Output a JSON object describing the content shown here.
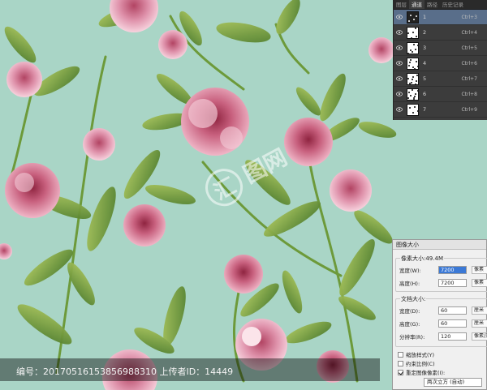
{
  "channels_panel": {
    "tabs": [
      "图层",
      "通道",
      "路径",
      "历史记录"
    ],
    "active_tab": 1,
    "channels": [
      {
        "name": "1",
        "shortcut": "Ctrl+3",
        "selected": true
      },
      {
        "name": "2",
        "shortcut": "Ctrl+4",
        "selected": false
      },
      {
        "name": "3",
        "shortcut": "Ctrl+5",
        "selected": false
      },
      {
        "name": "4",
        "shortcut": "Ctrl+6",
        "selected": false
      },
      {
        "name": "5",
        "shortcut": "Ctrl+7",
        "selected": false
      },
      {
        "name": "6",
        "shortcut": "Ctrl+8",
        "selected": false
      },
      {
        "name": "7",
        "shortcut": "Ctrl+9",
        "selected": false
      }
    ]
  },
  "image_size_dialog": {
    "title": "图像大小",
    "pixel_dimensions": {
      "legend": "像素大小:49.4M",
      "width_label": "宽度(W):",
      "width_value": "7200",
      "width_unit": "像素",
      "height_label": "高度(H):",
      "height_value": "7200",
      "height_unit": "像素"
    },
    "document_size": {
      "legend": "文档大小:",
      "width_label": "宽度(D):",
      "width_value": "60",
      "width_unit": "厘米",
      "height_label": "高度(G):",
      "height_value": "60",
      "height_unit": "厘米",
      "resolution_label": "分辨率(R):",
      "resolution_value": "120",
      "resolution_unit": "像素/英寸"
    },
    "checkboxes": [
      {
        "label": "缩放样式(Y)",
        "checked": false
      },
      {
        "label": "约束比例(C)",
        "checked": false
      },
      {
        "label": "重定图像像素(I):",
        "checked": true
      }
    ],
    "resample_method": "两次立方 (自动)"
  },
  "watermark": {
    "footer_text": "编号：20170516153856988310 上传者ID：14449",
    "logo_glyph": "汇",
    "logo_text": "图网"
  },
  "colors": {
    "background": "#a9d5c6",
    "panel_bg": "#3c3c3c",
    "selected_channel": "#596e8a",
    "highlight": "#3b79d6",
    "flower_pink": "#d07b97",
    "leaf_green": "#6f9a3e"
  }
}
